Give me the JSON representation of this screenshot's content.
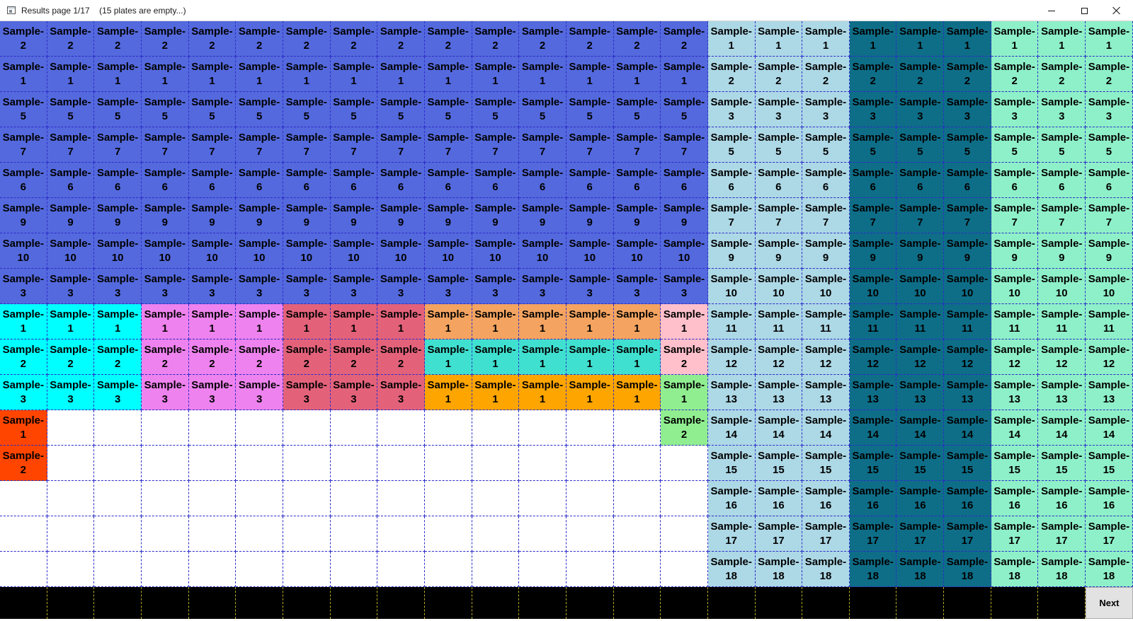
{
  "window": {
    "title": "Results page 1/17    (15 plates are empty...)"
  },
  "sample_prefix": "Sample-",
  "colors": {
    "royalblue": "#5469dd",
    "lightblue": "#add8e6",
    "teal": "#0e6e88",
    "aquamarine": "#8ef0c8",
    "cyan": "#00ffff",
    "violet": "#ee82ee",
    "crimson": "#e3627a",
    "sandy": "#f4a460",
    "turquoise": "#40e0d0",
    "pink": "#ffc0cb",
    "orange": "#ffa500",
    "lightgreen": "#90ee90",
    "orangered": "#ff4500",
    "empty": "#ffffff",
    "footer": "#000000"
  },
  "grid": {
    "columns": 24,
    "rows": [
      {
        "c": [
          "royalblue",
          "royalblue",
          "royalblue",
          "royalblue",
          "royalblue",
          "royalblue",
          "royalblue",
          "royalblue",
          "royalblue",
          "royalblue",
          "royalblue",
          "royalblue",
          "royalblue",
          "royalblue",
          "royalblue",
          "lightblue",
          "lightblue",
          "lightblue",
          "teal",
          "teal",
          "teal",
          "aquamarine",
          "aquamarine",
          "aquamarine"
        ],
        "n": [
          "2",
          "2",
          "2",
          "2",
          "2",
          "2",
          "2",
          "2",
          "2",
          "2",
          "2",
          "2",
          "2",
          "2",
          "2",
          "1",
          "1",
          "1",
          "1",
          "1",
          "1",
          "1",
          "1",
          "1"
        ]
      },
      {
        "c": [
          "royalblue",
          "royalblue",
          "royalblue",
          "royalblue",
          "royalblue",
          "royalblue",
          "royalblue",
          "royalblue",
          "royalblue",
          "royalblue",
          "royalblue",
          "royalblue",
          "royalblue",
          "royalblue",
          "royalblue",
          "lightblue",
          "lightblue",
          "lightblue",
          "teal",
          "teal",
          "teal",
          "aquamarine",
          "aquamarine",
          "aquamarine"
        ],
        "n": [
          "1",
          "1",
          "1",
          "1",
          "1",
          "1",
          "1",
          "1",
          "1",
          "1",
          "1",
          "1",
          "1",
          "1",
          "1",
          "2",
          "2",
          "2",
          "2",
          "2",
          "2",
          "2",
          "2",
          "2"
        ]
      },
      {
        "c": [
          "royalblue",
          "royalblue",
          "royalblue",
          "royalblue",
          "royalblue",
          "royalblue",
          "royalblue",
          "royalblue",
          "royalblue",
          "royalblue",
          "royalblue",
          "royalblue",
          "royalblue",
          "royalblue",
          "royalblue",
          "lightblue",
          "lightblue",
          "lightblue",
          "teal",
          "teal",
          "teal",
          "aquamarine",
          "aquamarine",
          "aquamarine"
        ],
        "n": [
          "5",
          "5",
          "5",
          "5",
          "5",
          "5",
          "5",
          "5",
          "5",
          "5",
          "5",
          "5",
          "5",
          "5",
          "5",
          "3",
          "3",
          "3",
          "3",
          "3",
          "3",
          "3",
          "3",
          "3"
        ]
      },
      {
        "c": [
          "royalblue",
          "royalblue",
          "royalblue",
          "royalblue",
          "royalblue",
          "royalblue",
          "royalblue",
          "royalblue",
          "royalblue",
          "royalblue",
          "royalblue",
          "royalblue",
          "royalblue",
          "royalblue",
          "royalblue",
          "lightblue",
          "lightblue",
          "lightblue",
          "teal",
          "teal",
          "teal",
          "aquamarine",
          "aquamarine",
          "aquamarine"
        ],
        "n": [
          "7",
          "7",
          "7",
          "7",
          "7",
          "7",
          "7",
          "7",
          "7",
          "7",
          "7",
          "7",
          "7",
          "7",
          "7",
          "5",
          "5",
          "5",
          "5",
          "5",
          "5",
          "5",
          "5",
          "5"
        ]
      },
      {
        "c": [
          "royalblue",
          "royalblue",
          "royalblue",
          "royalblue",
          "royalblue",
          "royalblue",
          "royalblue",
          "royalblue",
          "royalblue",
          "royalblue",
          "royalblue",
          "royalblue",
          "royalblue",
          "royalblue",
          "royalblue",
          "lightblue",
          "lightblue",
          "lightblue",
          "teal",
          "teal",
          "teal",
          "aquamarine",
          "aquamarine",
          "aquamarine"
        ],
        "n": [
          "6",
          "6",
          "6",
          "6",
          "6",
          "6",
          "6",
          "6",
          "6",
          "6",
          "6",
          "6",
          "6",
          "6",
          "6",
          "6",
          "6",
          "6",
          "6",
          "6",
          "6",
          "6",
          "6",
          "6"
        ]
      },
      {
        "c": [
          "royalblue",
          "royalblue",
          "royalblue",
          "royalblue",
          "royalblue",
          "royalblue",
          "royalblue",
          "royalblue",
          "royalblue",
          "royalblue",
          "royalblue",
          "royalblue",
          "royalblue",
          "royalblue",
          "royalblue",
          "lightblue",
          "lightblue",
          "lightblue",
          "teal",
          "teal",
          "teal",
          "aquamarine",
          "aquamarine",
          "aquamarine"
        ],
        "n": [
          "9",
          "9",
          "9",
          "9",
          "9",
          "9",
          "9",
          "9",
          "9",
          "9",
          "9",
          "9",
          "9",
          "9",
          "9",
          "7",
          "7",
          "7",
          "7",
          "7",
          "7",
          "7",
          "7",
          "7"
        ]
      },
      {
        "c": [
          "royalblue",
          "royalblue",
          "royalblue",
          "royalblue",
          "royalblue",
          "royalblue",
          "royalblue",
          "royalblue",
          "royalblue",
          "royalblue",
          "royalblue",
          "royalblue",
          "royalblue",
          "royalblue",
          "royalblue",
          "lightblue",
          "lightblue",
          "lightblue",
          "teal",
          "teal",
          "teal",
          "aquamarine",
          "aquamarine",
          "aquamarine"
        ],
        "n": [
          "10",
          "10",
          "10",
          "10",
          "10",
          "10",
          "10",
          "10",
          "10",
          "10",
          "10",
          "10",
          "10",
          "10",
          "10",
          "9",
          "9",
          "9",
          "9",
          "9",
          "9",
          "9",
          "9",
          "9"
        ]
      },
      {
        "c": [
          "royalblue",
          "royalblue",
          "royalblue",
          "royalblue",
          "royalblue",
          "royalblue",
          "royalblue",
          "royalblue",
          "royalblue",
          "royalblue",
          "royalblue",
          "royalblue",
          "royalblue",
          "royalblue",
          "royalblue",
          "lightblue",
          "lightblue",
          "lightblue",
          "teal",
          "teal",
          "teal",
          "aquamarine",
          "aquamarine",
          "aquamarine"
        ],
        "n": [
          "3",
          "3",
          "3",
          "3",
          "3",
          "3",
          "3",
          "3",
          "3",
          "3",
          "3",
          "3",
          "3",
          "3",
          "3",
          "10",
          "10",
          "10",
          "10",
          "10",
          "10",
          "10",
          "10",
          "10"
        ]
      },
      {
        "c": [
          "cyan",
          "cyan",
          "cyan",
          "violet",
          "violet",
          "violet",
          "crimson",
          "crimson",
          "crimson",
          "sandy",
          "sandy",
          "sandy",
          "sandy",
          "sandy",
          "pink",
          "lightblue",
          "lightblue",
          "lightblue",
          "teal",
          "teal",
          "teal",
          "aquamarine",
          "aquamarine",
          "aquamarine"
        ],
        "n": [
          "1",
          "1",
          "1",
          "1",
          "1",
          "1",
          "1",
          "1",
          "1",
          "1",
          "1",
          "1",
          "1",
          "1",
          "1",
          "11",
          "11",
          "11",
          "11",
          "11",
          "11",
          "11",
          "11",
          "11"
        ]
      },
      {
        "c": [
          "cyan",
          "cyan",
          "cyan",
          "violet",
          "violet",
          "violet",
          "crimson",
          "crimson",
          "crimson",
          "turquoise",
          "turquoise",
          "turquoise",
          "turquoise",
          "turquoise",
          "pink",
          "lightblue",
          "lightblue",
          "lightblue",
          "teal",
          "teal",
          "teal",
          "aquamarine",
          "aquamarine",
          "aquamarine"
        ],
        "n": [
          "2",
          "2",
          "2",
          "2",
          "2",
          "2",
          "2",
          "2",
          "2",
          "1",
          "1",
          "1",
          "1",
          "1",
          "2",
          "12",
          "12",
          "12",
          "12",
          "12",
          "12",
          "12",
          "12",
          "12"
        ]
      },
      {
        "c": [
          "cyan",
          "cyan",
          "cyan",
          "violet",
          "violet",
          "violet",
          "crimson",
          "crimson",
          "crimson",
          "orange",
          "orange",
          "orange",
          "orange",
          "orange",
          "lightgreen",
          "lightblue",
          "lightblue",
          "lightblue",
          "teal",
          "teal",
          "teal",
          "aquamarine",
          "aquamarine",
          "aquamarine"
        ],
        "n": [
          "3",
          "3",
          "3",
          "3",
          "3",
          "3",
          "3",
          "3",
          "3",
          "1",
          "1",
          "1",
          "1",
          "1",
          "1",
          "13",
          "13",
          "13",
          "13",
          "13",
          "13",
          "13",
          "13",
          "13"
        ]
      },
      {
        "c": [
          "orangered",
          "empty",
          "empty",
          "empty",
          "empty",
          "empty",
          "empty",
          "empty",
          "empty",
          "empty",
          "empty",
          "empty",
          "empty",
          "empty",
          "lightgreen",
          "lightblue",
          "lightblue",
          "lightblue",
          "teal",
          "teal",
          "teal",
          "aquamarine",
          "aquamarine",
          "aquamarine"
        ],
        "n": [
          "1",
          "",
          "",
          "",
          "",
          "",
          "",
          "",
          "",
          "",
          "",
          "",
          "",
          "",
          "2",
          "14",
          "14",
          "14",
          "14",
          "14",
          "14",
          "14",
          "14",
          "14"
        ]
      },
      {
        "c": [
          "orangered",
          "empty",
          "empty",
          "empty",
          "empty",
          "empty",
          "empty",
          "empty",
          "empty",
          "empty",
          "empty",
          "empty",
          "empty",
          "empty",
          "empty",
          "lightblue",
          "lightblue",
          "lightblue",
          "teal",
          "teal",
          "teal",
          "aquamarine",
          "aquamarine",
          "aquamarine"
        ],
        "n": [
          "2",
          "",
          "",
          "",
          "",
          "",
          "",
          "",
          "",
          "",
          "",
          "",
          "",
          "",
          "",
          "15",
          "15",
          "15",
          "15",
          "15",
          "15",
          "15",
          "15",
          "15"
        ]
      },
      {
        "c": [
          "empty",
          "empty",
          "empty",
          "empty",
          "empty",
          "empty",
          "empty",
          "empty",
          "empty",
          "empty",
          "empty",
          "empty",
          "empty",
          "empty",
          "empty",
          "lightblue",
          "lightblue",
          "lightblue",
          "teal",
          "teal",
          "teal",
          "aquamarine",
          "aquamarine",
          "aquamarine"
        ],
        "n": [
          "",
          "",
          "",
          "",
          "",
          "",
          "",
          "",
          "",
          "",
          "",
          "",
          "",
          "",
          "",
          "16",
          "16",
          "16",
          "16",
          "16",
          "16",
          "16",
          "16",
          "16"
        ]
      },
      {
        "c": [
          "empty",
          "empty",
          "empty",
          "empty",
          "empty",
          "empty",
          "empty",
          "empty",
          "empty",
          "empty",
          "empty",
          "empty",
          "empty",
          "empty",
          "empty",
          "lightblue",
          "lightblue",
          "lightblue",
          "teal",
          "teal",
          "teal",
          "aquamarine",
          "aquamarine",
          "aquamarine"
        ],
        "n": [
          "",
          "",
          "",
          "",
          "",
          "",
          "",
          "",
          "",
          "",
          "",
          "",
          "",
          "",
          "",
          "17",
          "17",
          "17",
          "17",
          "17",
          "17",
          "17",
          "17",
          "17"
        ]
      },
      {
        "c": [
          "empty",
          "empty",
          "empty",
          "empty",
          "empty",
          "empty",
          "empty",
          "empty",
          "empty",
          "empty",
          "empty",
          "empty",
          "empty",
          "empty",
          "empty",
          "lightblue",
          "lightblue",
          "lightblue",
          "teal",
          "teal",
          "teal",
          "aquamarine",
          "aquamarine",
          "aquamarine"
        ],
        "n": [
          "",
          "",
          "",
          "",
          "",
          "",
          "",
          "",
          "",
          "",
          "",
          "",
          "",
          "",
          "",
          "18",
          "18",
          "18",
          "18",
          "18",
          "18",
          "18",
          "18",
          "18"
        ]
      }
    ]
  },
  "footer": {
    "next_label": "Next"
  }
}
